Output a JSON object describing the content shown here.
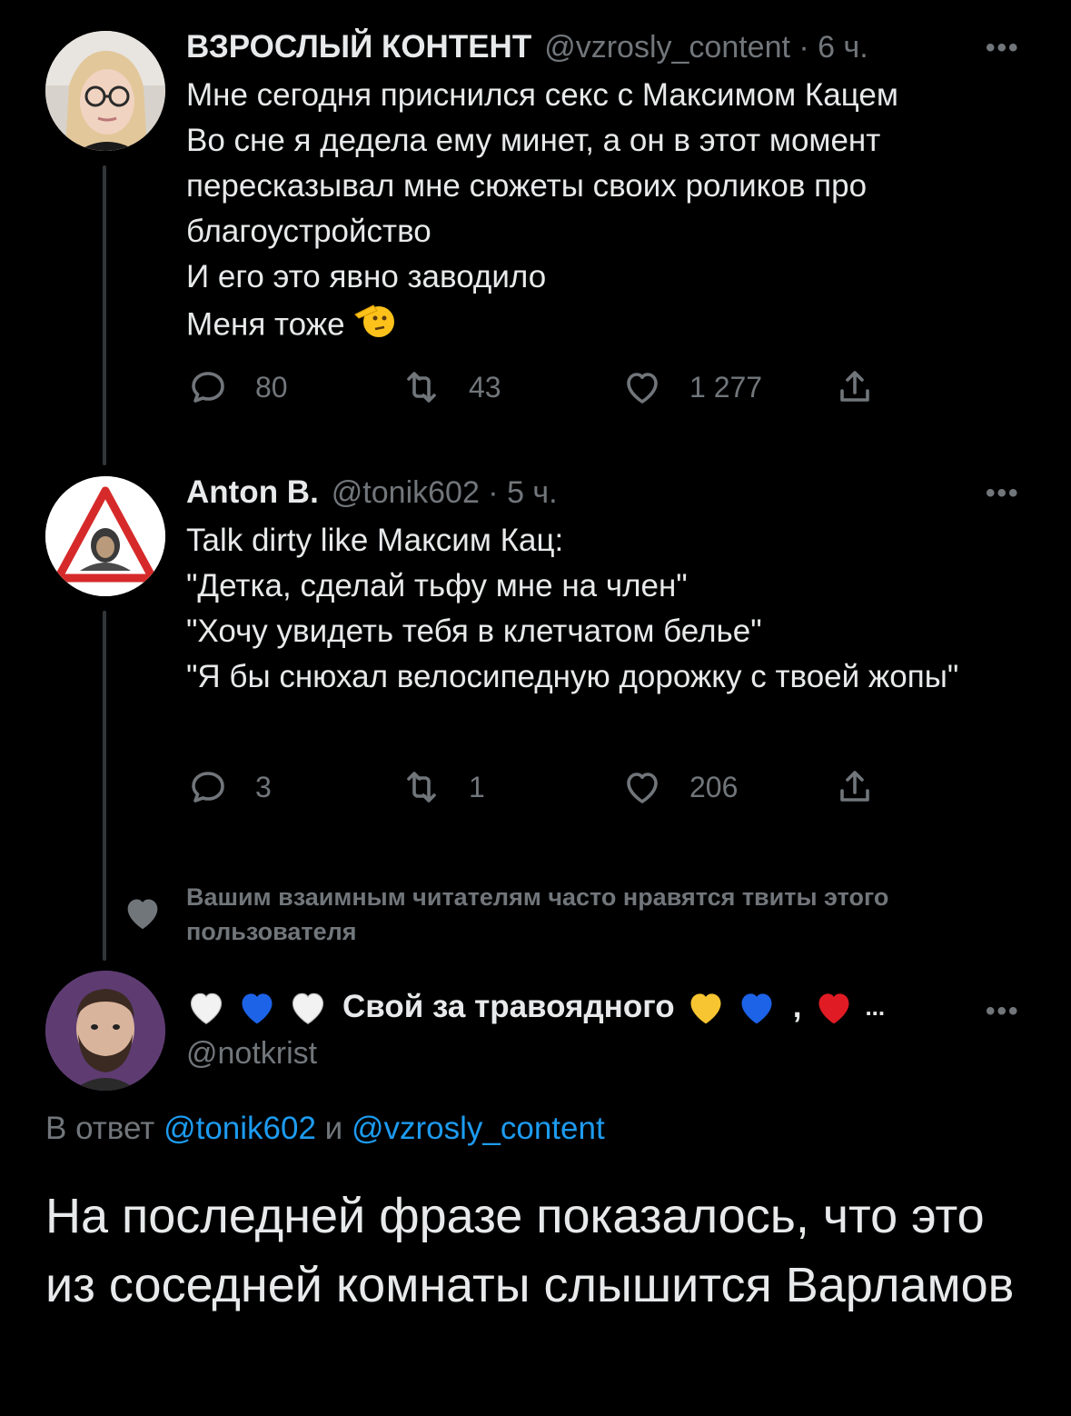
{
  "tweets": [
    {
      "name": "ВЗРОСЛЫЙ КОНТЕНТ",
      "handle": "@vzrosly_content · 6 ч.",
      "text": "Мне сегодня приснился секс с Максимом Кацем\nВо сне я дедела ему минет, а он в этот момент пересказывал мне сюжеты своих роликов про благоустройство\nИ его это явно заводило\nМеня тоже",
      "emoji_icon": "saluting-face-icon",
      "replies": "80",
      "retweets": "43",
      "likes": "1 277"
    },
    {
      "name": "Anton B.",
      "handle": "@tonik602 · 5 ч.",
      "text": "Talk dirty like Максим Кац:\n\"Детка, сделай тьфу мне на член\"\n\"Хочу увидеть тебя в клетчатом белье\"\n\"Я бы снюхал велосипедную дорожку с твоей жопы\"",
      "replies": "3",
      "retweets": "1",
      "likes": "206"
    }
  ],
  "social_context": "Вашим взаимным читателям часто нравятся твиты этого пользователя",
  "main_tweet": {
    "name": "Свой за травоядного",
    "separator": ",",
    "ellipsis": "...",
    "handle": "@notkrist",
    "reply_prefix": "В ответ",
    "reply_to_1": "@tonik602",
    "reply_joiner": "и",
    "reply_to_2": "@vzrosly_content",
    "text": "На последней фразе показалось, что это из соседней комнаты слышится Варламов"
  },
  "more_label": "•••",
  "colors": {
    "background": "#000000",
    "text": "#e7e9ea",
    "secondary": "#71767b",
    "link": "#1d9bf0",
    "thread_line": "#333639"
  }
}
